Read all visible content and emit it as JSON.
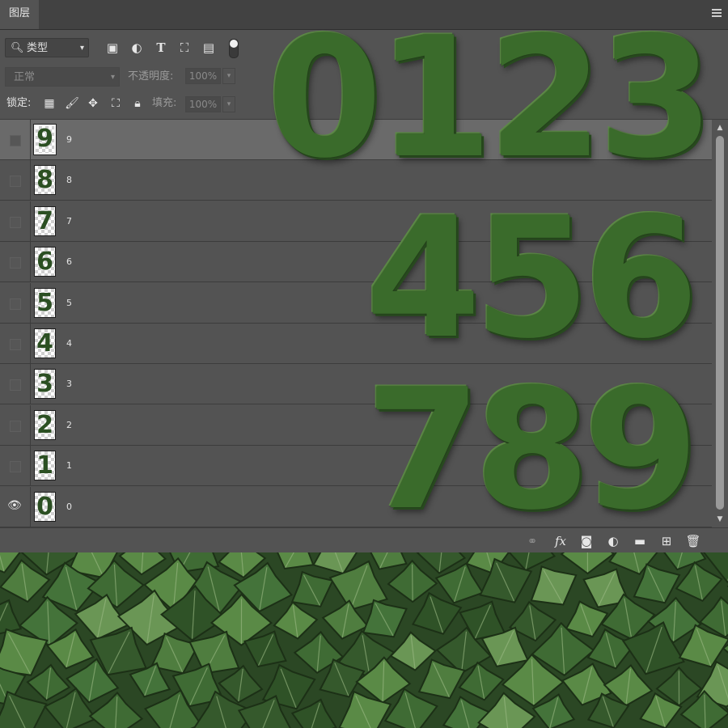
{
  "panel": {
    "tab": "图层",
    "filter": {
      "kind_label": "类型"
    },
    "blend_mode": "正常",
    "opacity": {
      "label": "不透明度:",
      "value": "100%"
    },
    "lock": {
      "label": "锁定:"
    },
    "fill": {
      "label": "填充:",
      "value": "100%"
    }
  },
  "layers": [
    {
      "name": "9",
      "thumb": "9",
      "visible": false,
      "selected": true
    },
    {
      "name": "8",
      "thumb": "8",
      "visible": false,
      "selected": false
    },
    {
      "name": "7",
      "thumb": "7",
      "visible": false,
      "selected": false
    },
    {
      "name": "6",
      "thumb": "6",
      "visible": false,
      "selected": false
    },
    {
      "name": "5",
      "thumb": "5",
      "visible": false,
      "selected": false
    },
    {
      "name": "4",
      "thumb": "4",
      "visible": false,
      "selected": false
    },
    {
      "name": "3",
      "thumb": "3",
      "visible": false,
      "selected": false
    },
    {
      "name": "2",
      "thumb": "2",
      "visible": false,
      "selected": false
    },
    {
      "name": "1",
      "thumb": "1",
      "visible": false,
      "selected": false
    },
    {
      "name": "0",
      "thumb": "0",
      "visible": true,
      "selected": false
    }
  ],
  "overlay_digits": {
    "row1": "0123",
    "row2": "456",
    "row3": "789"
  },
  "colors": {
    "panel_bg": "#535353",
    "selected_row": "#6a6a6a",
    "grass_green": "#3a6b2b"
  },
  "icons": {
    "filter": [
      "image-filter-icon",
      "adjustment-filter-icon",
      "type-filter-icon",
      "shape-filter-icon",
      "smart-object-filter-icon"
    ],
    "lock": [
      "lock-transparent-icon",
      "lock-paint-icon",
      "lock-position-icon",
      "lock-artboard-icon",
      "lock-all-icon"
    ],
    "footer": [
      "link-layers-icon",
      "fx-icon",
      "add-mask-icon",
      "new-adjustment-icon",
      "new-group-icon",
      "new-layer-icon",
      "delete-icon"
    ]
  }
}
